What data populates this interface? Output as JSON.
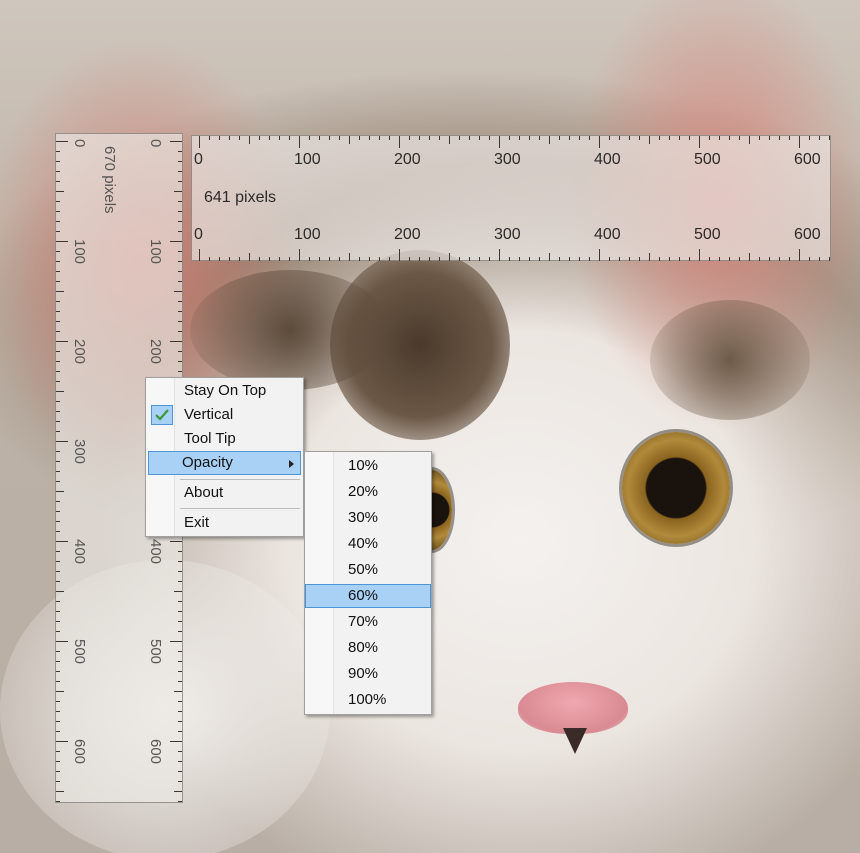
{
  "horizontal_ruler": {
    "labels_top": [
      "0",
      "100",
      "200",
      "300",
      "400",
      "500",
      "600"
    ],
    "labels_bottom": [
      "0",
      "100",
      "200",
      "300",
      "400",
      "500",
      "600"
    ],
    "size_text": "641 pixels"
  },
  "vertical_ruler": {
    "labels_left": [
      "0",
      "100",
      "200",
      "300",
      "400",
      "500",
      "600"
    ],
    "labels_right": [
      "0",
      "100",
      "200",
      "300",
      "400",
      "500",
      "600"
    ],
    "size_text": "670 pixels"
  },
  "context_menu": {
    "items": [
      {
        "label": "Stay On Top",
        "checked": false
      },
      {
        "label": "Vertical",
        "checked": true
      },
      {
        "label": "Tool Tip",
        "checked": false
      },
      {
        "label": "Opacity",
        "has_submenu": true,
        "highlighted": true
      },
      {
        "label": "About"
      },
      {
        "label": "Exit"
      }
    ]
  },
  "opacity_submenu": {
    "items": [
      "10%",
      "20%",
      "30%",
      "40%",
      "50%",
      "60%",
      "70%",
      "80%",
      "90%",
      "100%"
    ],
    "selected": "60%"
  },
  "icons": {
    "check": "check-icon",
    "submenu_arrow": "submenu-arrow-icon"
  },
  "colors": {
    "menu_highlight": "#a9d0f5",
    "menu_highlight_border": "#4d94d8",
    "ruler_text": "#2d2a28"
  }
}
